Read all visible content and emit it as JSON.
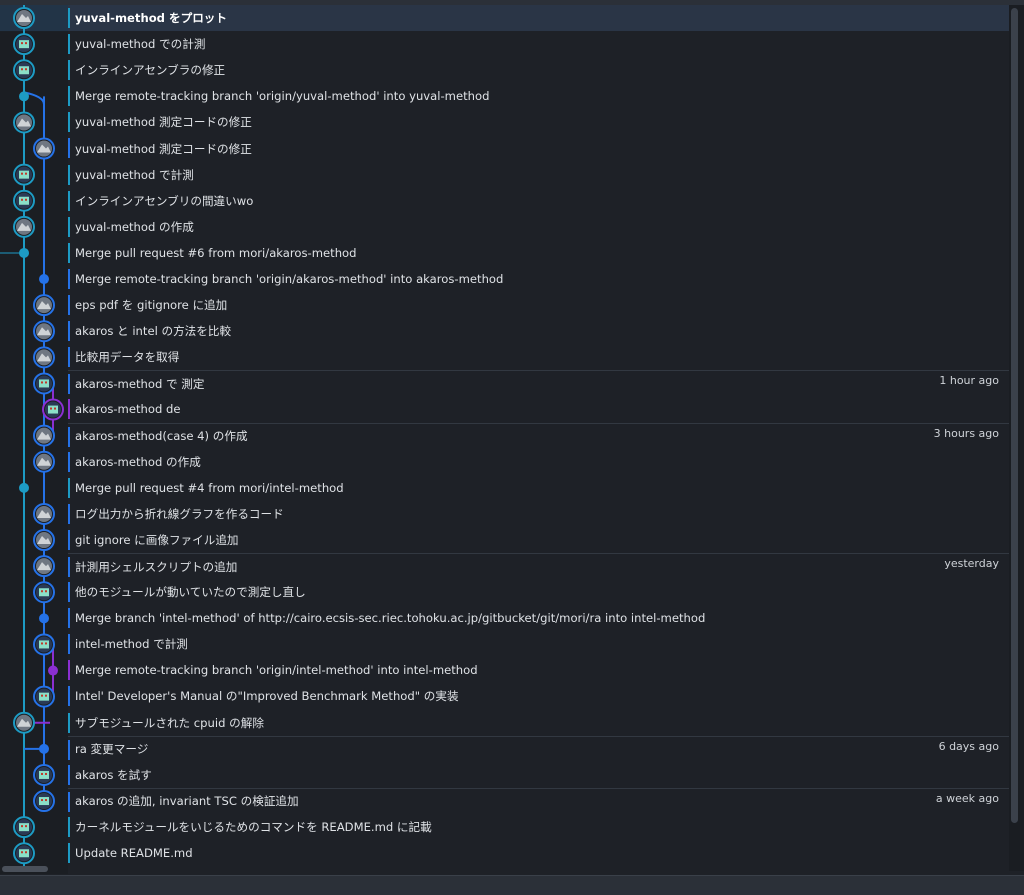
{
  "lane_colors": [
    "#1d9bc4",
    "#1d9bc4",
    "#2572e8",
    "#8b2fd1"
  ],
  "commits": [
    {
      "message": "yuval-method をプロット",
      "time": "",
      "lane": 0,
      "avatar": "mountain-avatar",
      "selected": true,
      "sep": false
    },
    {
      "message": "yuval-method での計測",
      "time": "",
      "lane": 0,
      "avatar": "pixel-avatar",
      "selected": false,
      "sep": false
    },
    {
      "message": "インラインアセンブラの修正",
      "time": "",
      "lane": 0,
      "avatar": "pixel-avatar",
      "selected": false,
      "sep": false
    },
    {
      "message": "Merge remote-tracking branch 'origin/yuval-method' into yuval-method",
      "time": "",
      "lane": 0,
      "avatar": "dot",
      "selected": false,
      "sep": false
    },
    {
      "message": "yuval-method 測定コードの修正",
      "time": "",
      "lane": 0,
      "avatar": "mountain-avatar",
      "selected": false,
      "sep": false
    },
    {
      "message": "yuval-method 測定コードの修正",
      "time": "",
      "lane": 2,
      "avatar": "mountain-avatar",
      "selected": false,
      "sep": false
    },
    {
      "message": "yuval-method で計測",
      "time": "",
      "lane": 0,
      "avatar": "pixel-avatar",
      "selected": false,
      "sep": false
    },
    {
      "message": "インラインアセンブリの間違いwo",
      "time": "",
      "lane": 0,
      "avatar": "pixel-avatar",
      "selected": false,
      "sep": false
    },
    {
      "message": "yuval-method の作成",
      "time": "",
      "lane": 0,
      "avatar": "mountain-avatar",
      "selected": false,
      "sep": false
    },
    {
      "message": "Merge pull request #6 from mori/akaros-method",
      "time": "",
      "lane": 0,
      "avatar": "dot",
      "selected": false,
      "sep": false
    },
    {
      "message": "Merge remote-tracking branch 'origin/akaros-method' into akaros-method",
      "time": "",
      "lane": 2,
      "avatar": "dot",
      "selected": false,
      "sep": false
    },
    {
      "message": "eps pdf を gitignore に追加",
      "time": "",
      "lane": 2,
      "avatar": "mountain-avatar",
      "selected": false,
      "sep": false
    },
    {
      "message": "akaros と intel の方法を比較",
      "time": "",
      "lane": 2,
      "avatar": "mountain-avatar",
      "selected": false,
      "sep": false
    },
    {
      "message": "比較用データを取得",
      "time": "",
      "lane": 2,
      "avatar": "mountain-avatar",
      "selected": false,
      "sep": false
    },
    {
      "message": "akaros-method で 測定",
      "time": "1 hour ago",
      "lane": 2,
      "avatar": "pixel-avatar",
      "selected": false,
      "sep": true
    },
    {
      "message": "akaros-method de",
      "time": "",
      "lane": 3,
      "avatar": "pixel-avatar",
      "selected": false,
      "sep": false
    },
    {
      "message": "akaros-method(case 4) の作成",
      "time": "3 hours ago",
      "lane": 2,
      "avatar": "mountain-avatar",
      "selected": false,
      "sep": true
    },
    {
      "message": "akaros-method の作成",
      "time": "",
      "lane": 2,
      "avatar": "mountain-avatar",
      "selected": false,
      "sep": false
    },
    {
      "message": "Merge pull request #4 from mori/intel-method",
      "time": "",
      "lane": 0,
      "avatar": "dot",
      "selected": false,
      "sep": false
    },
    {
      "message": "ログ出力から折れ線グラフを作るコード",
      "time": "",
      "lane": 2,
      "avatar": "mountain-avatar",
      "selected": false,
      "sep": false
    },
    {
      "message": "git ignore に画像ファイル追加",
      "time": "",
      "lane": 2,
      "avatar": "mountain-avatar",
      "selected": false,
      "sep": false
    },
    {
      "message": "計測用シェルスクリプトの追加",
      "time": "yesterday",
      "lane": 2,
      "avatar": "mountain-avatar",
      "selected": false,
      "sep": true
    },
    {
      "message": "他のモジュールが動いていたので測定し直し",
      "time": "",
      "lane": 2,
      "avatar": "pixel-avatar",
      "selected": false,
      "sep": false
    },
    {
      "message": "Merge branch 'intel-method' of http://cairo.ecsis-sec.riec.tohoku.ac.jp/gitbucket/git/mori/ra into intel-method",
      "time": "",
      "lane": 2,
      "avatar": "dot",
      "selected": false,
      "sep": false
    },
    {
      "message": "intel-method で計測",
      "time": "",
      "lane": 2,
      "avatar": "pixel-avatar",
      "selected": false,
      "sep": false
    },
    {
      "message": "Merge remote-tracking branch 'origin/intel-method' into intel-method",
      "time": "",
      "lane": 3,
      "avatar": "dot",
      "selected": false,
      "sep": false
    },
    {
      "message": "Intel' Developer's Manual の\"Improved Benchmark Method\" の実装",
      "time": "",
      "lane": 2,
      "avatar": "pixel-avatar",
      "selected": false,
      "sep": false
    },
    {
      "message": "サブモジュールされた cpuid の解除",
      "time": "",
      "lane": 0,
      "avatar": "mountain-avatar",
      "selected": false,
      "sep": false
    },
    {
      "message": "ra 変更マージ",
      "time": "6 days ago",
      "lane": 2,
      "avatar": "dot",
      "selected": false,
      "sep": true
    },
    {
      "message": "akaros を試す",
      "time": "",
      "lane": 2,
      "avatar": "pixel-avatar",
      "selected": false,
      "sep": false
    },
    {
      "message": "akaros の追加, invariant TSC の検証追加",
      "time": "a week ago",
      "lane": 2,
      "avatar": "pixel-avatar",
      "selected": false,
      "sep": true
    },
    {
      "message": "カーネルモジュールをいじるためのコマンドを README.md に記載",
      "time": "",
      "lane": 0,
      "avatar": "pixel-avatar",
      "selected": false,
      "sep": false
    },
    {
      "message": "Update README.md",
      "time": "",
      "lane": 0,
      "avatar": "pixel-avatar",
      "selected": false,
      "sep": false
    }
  ]
}
